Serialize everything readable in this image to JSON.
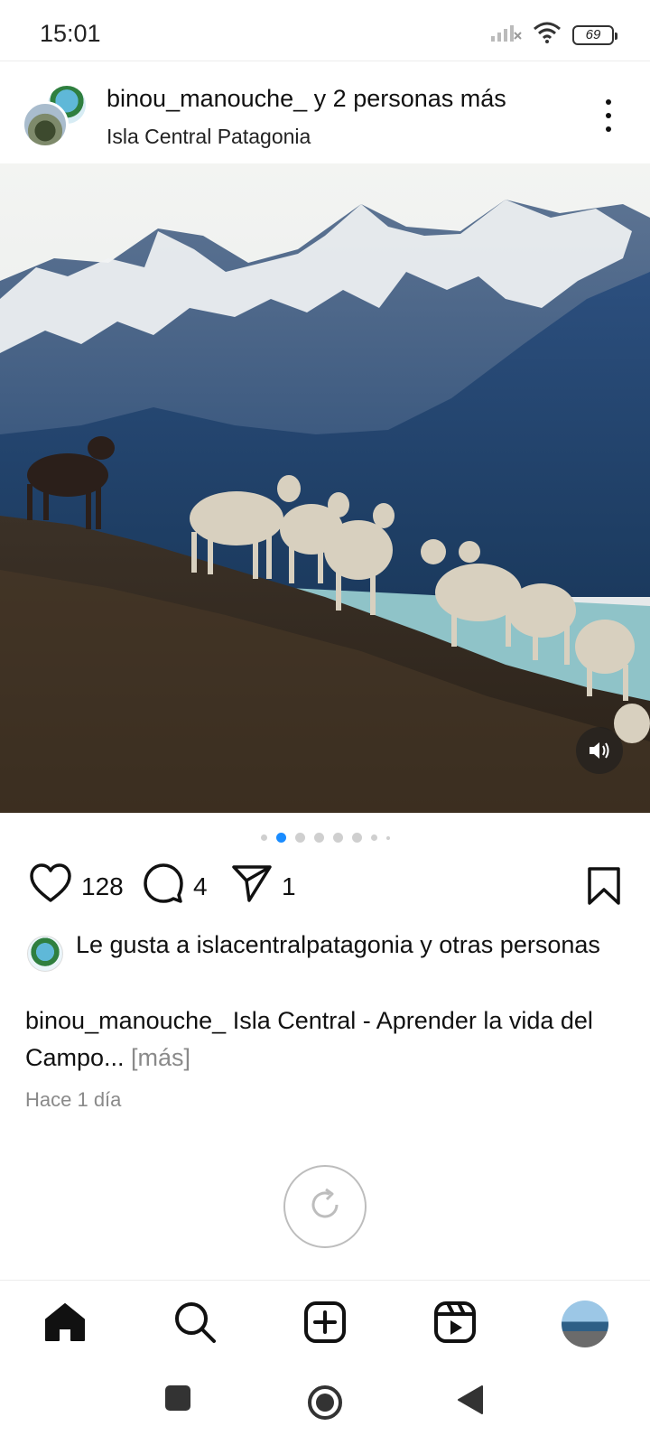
{
  "status_bar": {
    "time": "15:01",
    "battery": "69",
    "icons": [
      "signal-icon",
      "wifi-icon",
      "battery-icon"
    ]
  },
  "post": {
    "header": {
      "user_text": "binou_manouche_ y 2 personas más",
      "location": "Isla Central Patagonia"
    },
    "carousel": {
      "count": 8,
      "active": 1
    },
    "actions": {
      "likes": "128",
      "comments": "4",
      "shares": "1"
    },
    "likes_line": {
      "prefix": "Le gusta a ",
      "user": "islacentralpatagonia",
      "suffix": " y otras personas"
    },
    "caption": {
      "user": "binou_manouche_",
      "text": " Isla Central - Aprender la vida del Campo...",
      "more": " [más]"
    },
    "time_ago": "Hace 1 día"
  },
  "bottom_nav": {
    "items": [
      "home-icon",
      "search-icon",
      "create-icon",
      "reels-icon",
      "profile-avatar"
    ],
    "active": "home-icon"
  },
  "colors": {
    "accent": "#1a8cff",
    "text": "#111111",
    "muted": "#8a8a8a"
  }
}
